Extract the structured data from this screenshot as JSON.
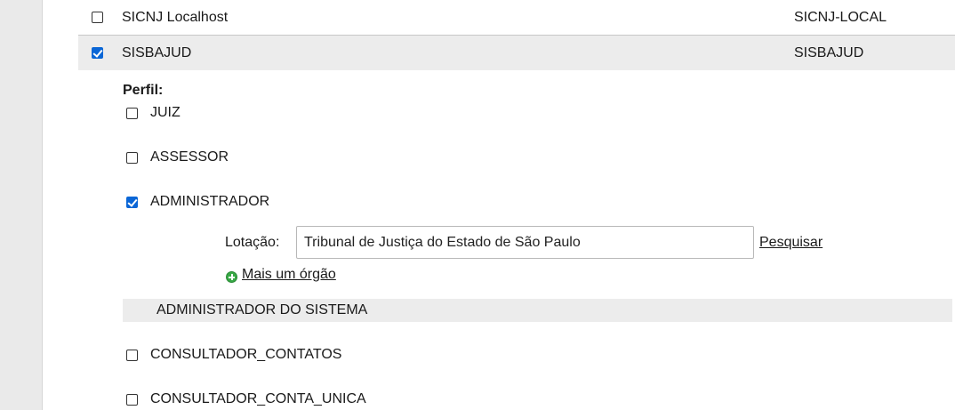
{
  "systems": [
    {
      "name": "SICNJ Localhost",
      "code": "SICNJ-LOCAL",
      "checked": false
    },
    {
      "name": "SISBAJUD",
      "code": "SISBAJUD",
      "checked": true
    }
  ],
  "perfil": {
    "label": "Perfil:",
    "roles": [
      {
        "label": "JUIZ",
        "checked": false
      },
      {
        "label": "ASSESSOR",
        "checked": false
      },
      {
        "label": "ADMINISTRADOR",
        "checked": true
      }
    ],
    "lotacao": {
      "label": "Lotação:",
      "value": "Tribunal de Justiça do Estado de São Paulo",
      "search_link": "Pesquisar",
      "add_link": "Mais um órgão"
    },
    "group_header": "ADMINISTRADOR DO SISTEMA",
    "group_roles": [
      {
        "label": "CONSULTADOR_CONTATOS",
        "checked": false
      },
      {
        "label": "CONSULTADOR_CONTA_UNICA",
        "checked": false
      }
    ]
  },
  "colors": {
    "accent": "#0a66d6",
    "add_icon": "#37a845",
    "row_highlight": "#ececec"
  }
}
